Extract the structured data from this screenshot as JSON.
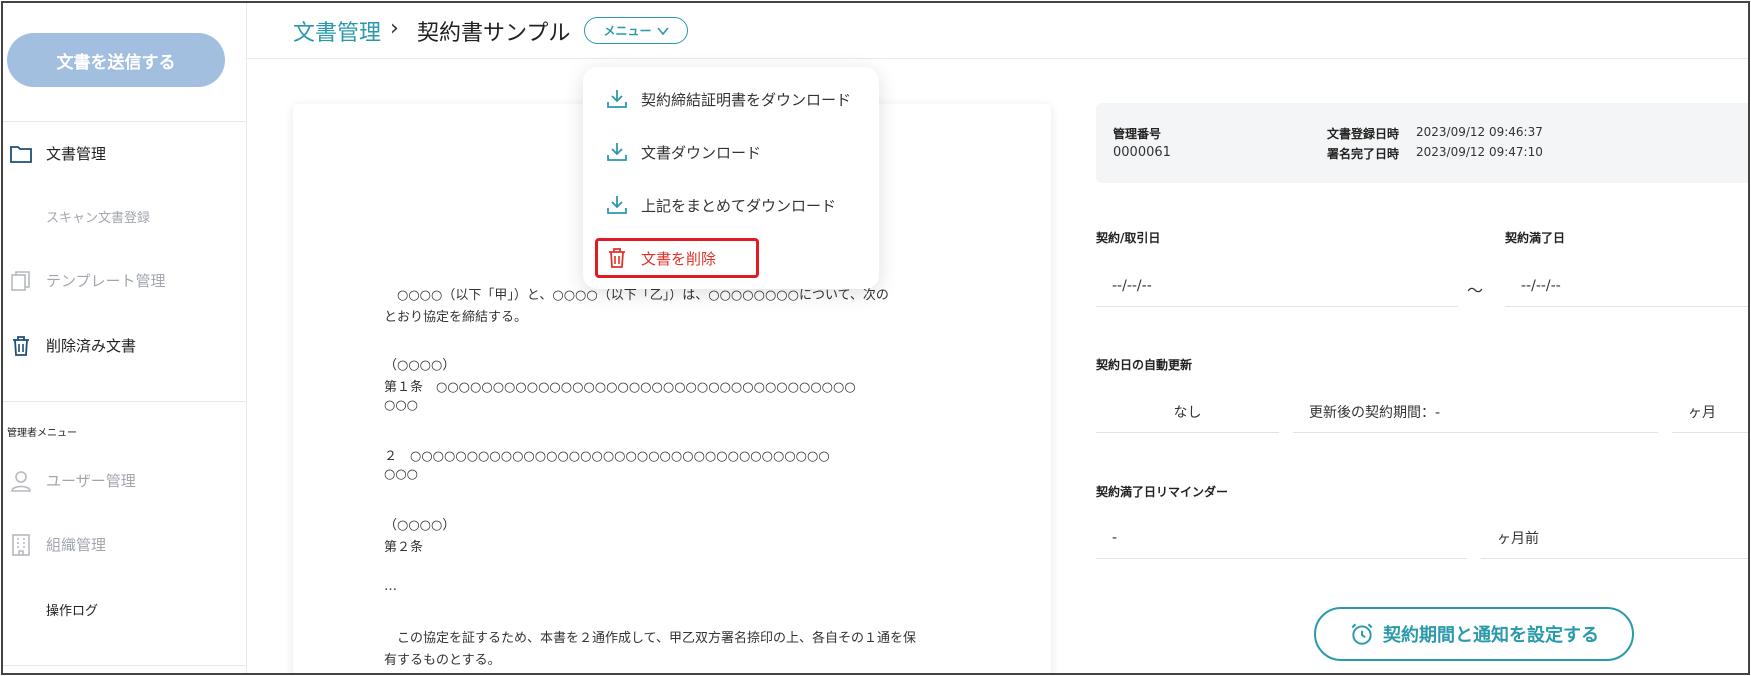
{
  "sidebar": {
    "send_button": "文書を送信する",
    "items": [
      {
        "label": "文書管理",
        "icon": "folder-icon"
      },
      {
        "label": "スキャン文書登録"
      },
      {
        "label": "テンプレート管理",
        "icon": "template-icon"
      },
      {
        "label": "削除済み文書",
        "icon": "trash-icon"
      }
    ],
    "admin_section_label": "管理者メニュー",
    "admin_items": [
      {
        "label": "ユーザー管理",
        "icon": "user-icon"
      },
      {
        "label": "組織管理",
        "icon": "building-icon"
      },
      {
        "label": "操作ログ"
      }
    ]
  },
  "header": {
    "breadcrumb_root": "文書管理",
    "breadcrumb_sep": "›",
    "breadcrumb_current": "契約書サンプル",
    "menu_label": "メニュー"
  },
  "dropdown": {
    "items": [
      {
        "label": "契約締結証明書をダウンロード",
        "icon": "download-icon"
      },
      {
        "label": "文書ダウンロード",
        "icon": "download-icon"
      },
      {
        "label": "上記をまとめてダウンロード",
        "icon": "download-icon"
      },
      {
        "label": "文書を削除",
        "icon": "trash-icon"
      }
    ]
  },
  "document": {
    "lines": [
      "　○○○○（以下「甲」）と、○○○○（以下「乙」）は、○○○○○○○○について、次の",
      "とおり協定を締結する。",
      "（○○○○）",
      "第１条　○○○○○○○○○○○○○○○○○○○○○○○○○○○○○○○○○○○○○",
      "○○○",
      "２　○○○○○○○○○○○○○○○○○○○○○○○○○○○○○○○○○○○○○",
      "○○○",
      "（○○○○）",
      "第２条",
      "…",
      "　この協定を証するため、本書を２通作成して、甲乙双方署名捺印の上、各自その１通を保",
      "有するものとする。"
    ]
  },
  "info": {
    "mgmt_no_label": "管理番号",
    "mgmt_no": "0000061",
    "registered_label": "文書登録日時",
    "registered_at": "2023/09/12 09:46:37",
    "signed_label": "署名完了日時",
    "signed_at": "2023/09/12 09:47:10"
  },
  "form": {
    "contract_date_label": "契約/取引日",
    "contract_date_value": "--/--/--",
    "tilde": "～",
    "expiry_label": "契約満了日",
    "expiry_value": "--/--/--",
    "auto_renew_label": "契約日の自動更新",
    "auto_renew_value": "なし",
    "renew_period_text": "更新後の契約期間：-",
    "months_unit": "ヶ月",
    "reminder_label": "契約満了日リマインダー",
    "reminder_value": "-",
    "reminder_unit": "ヶ月前",
    "settings_button": "契約期間と通知を設定する"
  },
  "colors": {
    "accent": "#2a9aab",
    "send_button_bg": "#a3bfdf",
    "danger": "#e0342b",
    "highlight": "#e11b22"
  }
}
